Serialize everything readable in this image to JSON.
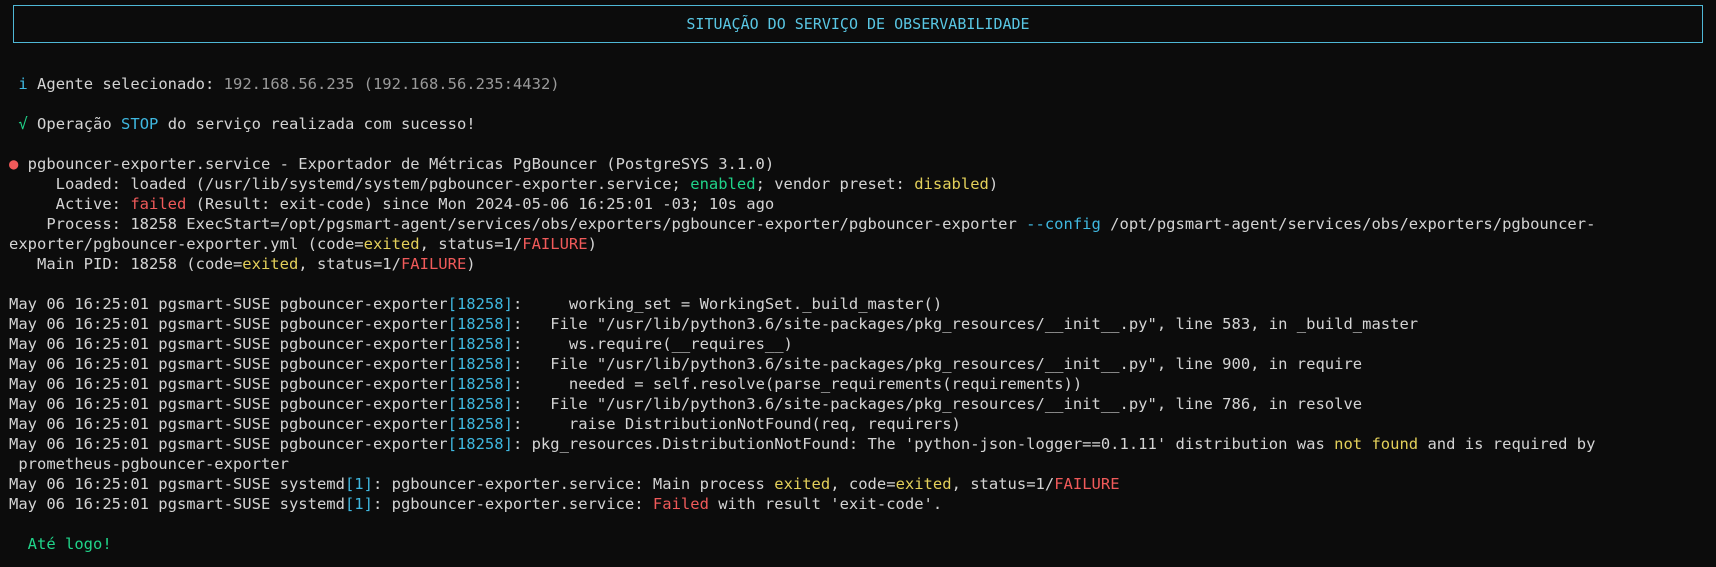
{
  "header": {
    "title": "SITUAÇÃO DO SERVIÇO DE OBSERVABILIDADE"
  },
  "agent": {
    "icon": "info-icon",
    "icon_glyph": "i",
    "label": "Agente selecionado: ",
    "value": "192.168.56.235 (192.168.56.235:4432)"
  },
  "operation": {
    "icon": "check-icon",
    "icon_glyph": "√",
    "prefix": "Operação ",
    "action": "STOP",
    "suffix": " do serviço realizada com sucesso!"
  },
  "status": {
    "bullet": "●",
    "service_line": " pgbouncer-exporter.service - Exportador de Métricas PgBouncer (PostgreSYS 3.1.0)",
    "loaded_prefix": "     Loaded: loaded (/usr/lib/systemd/system/pgbouncer-exporter.service; ",
    "loaded_enabled": "enabled",
    "loaded_mid": "; vendor preset: ",
    "loaded_disabled": "disabled",
    "loaded_end": ")",
    "active_prefix": "     Active: ",
    "active_state": "failed",
    "active_rest": " (Result: exit-code) since Mon 2024-05-06 16:25:01 -03; 10s ago",
    "process_prefix": "    Process: 18258 ExecStart=/opt/pgsmart-agent/services/obs/exporters/pgbouncer-exporter/pgbouncer-exporter ",
    "process_flag": "--config",
    "process_path": " /opt/pgsmart-agent/services/obs/exporters/pgbouncer-",
    "process_cont": "exporter/pgbouncer-exporter.yml (code=",
    "process_code": "exited",
    "process_status": ", status=1/",
    "process_failure": "FAILURE",
    "process_end": ")",
    "mainpid_prefix": "   Main PID: 18258 (code=",
    "mainpid_code": "exited",
    "mainpid_status": ", status=1/",
    "mainpid_failure": "FAILURE",
    "mainpid_end": ")"
  },
  "logs": {
    "prefix": "May 06 16:25:01 pgsmart-SUSE pgbouncer-exporter",
    "pid": "[18258]",
    "lines": [
      ":     working_set = WorkingSet._build_master()",
      ":   File \"/usr/lib/python3.6/site-packages/pkg_resources/__init__.py\", line 583, in _build_master",
      ":     ws.require(__requires__)",
      ":   File \"/usr/lib/python3.6/site-packages/pkg_resources/__init__.py\", line 900, in require",
      ":     needed = self.resolve(parse_requirements(requirements))",
      ":   File \"/usr/lib/python3.6/site-packages/pkg_resources/__init__.py\", line 786, in resolve",
      ":     raise DistributionNotFound(req, requirers)"
    ],
    "error_a": ": pkg_resources.DistributionNotFound: The 'python-json-logger==0.1.11' distribution was ",
    "error_not_found": "not found",
    "error_b": " and is required by",
    "error_cont": " prometheus-pgbouncer-exporter",
    "systemd_prefix": "May 06 16:25:01 pgsmart-SUSE systemd",
    "systemd_pid": "[1]",
    "sd1_a": ": pgbouncer-exporter.service: Main process ",
    "sd1_exited": "exited",
    "sd1_b": ", code=",
    "sd1_exited2": "exited",
    "sd1_c": ", status=1/",
    "sd1_failure": "FAILURE",
    "sd2_a": ": pgbouncer-exporter.service: ",
    "sd2_failed": "Failed",
    "sd2_b": " with result 'exit-code'."
  },
  "footer": {
    "goodbye": "Até logo!"
  },
  "colors": {
    "background": "#0c0c0c",
    "text": "#d4d4d4",
    "accent_cyan": "#3fb8e0",
    "success_green": "#20d48a",
    "warning_yellow": "#e3d05a",
    "error_red": "#f05a5a",
    "muted_grey": "#9a9a9a"
  }
}
